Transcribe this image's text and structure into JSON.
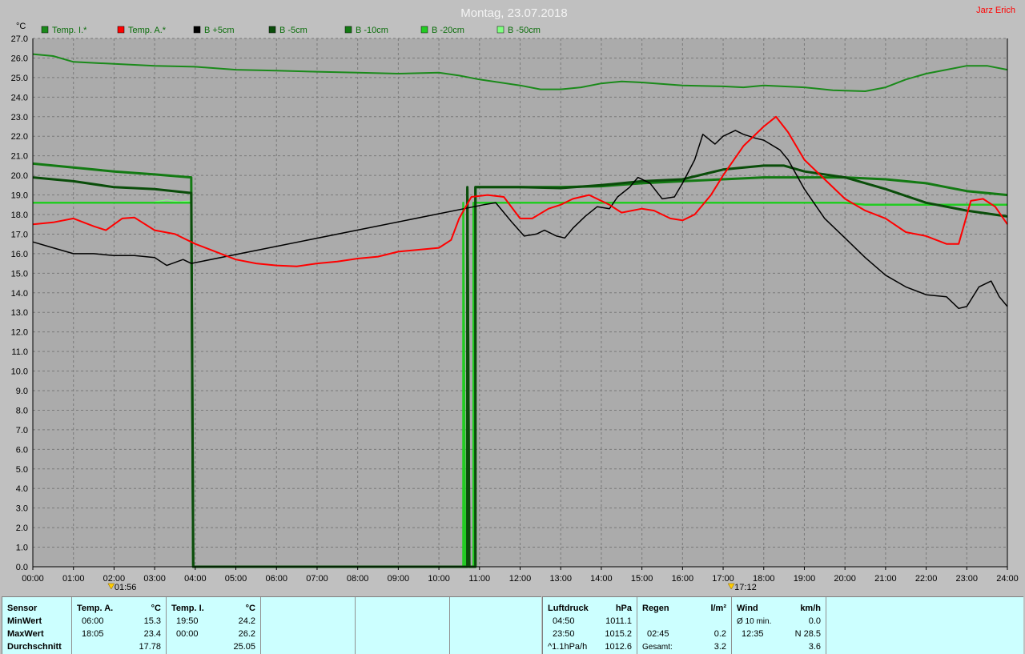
{
  "header": {
    "title": "Montag, 23.07.2018",
    "author": "Jarz Erich",
    "y_unit": "°C"
  },
  "colors": {
    "background": "#c0c0c0",
    "plot_background": "#ababab",
    "grid": "#7a7a7a",
    "temp_inside": "#1a8a1a",
    "temp_outside": "#ff0000",
    "soil_plus5": "#000000",
    "soil_minus5": "#0a4d0a",
    "soil_minus10": "#137a13",
    "soil_minus20": "#22cc22",
    "soil_minus50": "#80ff80"
  },
  "markers": [
    {
      "x": 1.93,
      "label": "01:56",
      "icon": "sunrise-icon"
    },
    {
      "x": 17.2,
      "label": "17:12",
      "icon": "sunset-icon"
    }
  ],
  "chart_data": {
    "type": "line",
    "xlim": [
      0,
      24
    ],
    "ylim": [
      0,
      27
    ],
    "ylabel": "°C",
    "grid": true,
    "legend_position": "top-left",
    "x_ticks": [
      "00:00",
      "01:00",
      "02:00",
      "03:00",
      "04:00",
      "05:00",
      "06:00",
      "07:00",
      "08:00",
      "09:00",
      "10:00",
      "11:00",
      "12:00",
      "13:00",
      "14:00",
      "15:00",
      "16:00",
      "17:00",
      "18:00",
      "19:00",
      "20:00",
      "21:00",
      "22:00",
      "23:00",
      "24:00"
    ],
    "y_ticks": [
      "0.0",
      "1.0",
      "2.0",
      "3.0",
      "4.0",
      "5.0",
      "6.0",
      "7.0",
      "8.0",
      "9.0",
      "10.0",
      "11.0",
      "12.0",
      "13.0",
      "14.0",
      "15.0",
      "16.0",
      "17.0",
      "18.0",
      "19.0",
      "20.0",
      "21.0",
      "22.0",
      "23.0",
      "24.0",
      "25.0",
      "26.0",
      "27.0"
    ],
    "series": [
      {
        "name": "Temp. I.*",
        "color": "#1a8a1a",
        "width": 2,
        "points": [
          [
            0,
            26.2
          ],
          [
            0.5,
            26.1
          ],
          [
            1,
            25.8
          ],
          [
            2,
            25.7
          ],
          [
            3,
            25.6
          ],
          [
            4,
            25.55
          ],
          [
            5,
            25.4
          ],
          [
            6,
            25.35
          ],
          [
            7,
            25.3
          ],
          [
            8,
            25.25
          ],
          [
            9,
            25.2
          ],
          [
            10,
            25.25
          ],
          [
            10.5,
            25.1
          ],
          [
            11,
            24.9
          ],
          [
            12,
            24.6
          ],
          [
            12.5,
            24.4
          ],
          [
            13,
            24.4
          ],
          [
            13.5,
            24.5
          ],
          [
            14,
            24.7
          ],
          [
            14.5,
            24.8
          ],
          [
            15,
            24.75
          ],
          [
            16,
            24.6
          ],
          [
            17,
            24.55
          ],
          [
            17.5,
            24.5
          ],
          [
            18,
            24.6
          ],
          [
            19,
            24.5
          ],
          [
            19.7,
            24.35
          ],
          [
            20.5,
            24.3
          ],
          [
            21,
            24.5
          ],
          [
            21.5,
            24.9
          ],
          [
            22,
            25.2
          ],
          [
            22.5,
            25.4
          ],
          [
            23,
            25.6
          ],
          [
            23.5,
            25.6
          ],
          [
            24,
            25.4
          ]
        ]
      },
      {
        "name": "Temp. A.*",
        "color": "#ff0000",
        "width": 2,
        "points": [
          [
            0,
            17.5
          ],
          [
            0.5,
            17.6
          ],
          [
            1,
            17.8
          ],
          [
            1.5,
            17.4
          ],
          [
            1.8,
            17.2
          ],
          [
            2.2,
            17.8
          ],
          [
            2.5,
            17.85
          ],
          [
            3,
            17.2
          ],
          [
            3.5,
            17.0
          ],
          [
            4,
            16.5
          ],
          [
            4.5,
            16.1
          ],
          [
            5,
            15.7
          ],
          [
            5.5,
            15.5
          ],
          [
            6,
            15.4
          ],
          [
            6.5,
            15.35
          ],
          [
            7,
            15.5
          ],
          [
            7.5,
            15.6
          ],
          [
            8,
            15.75
          ],
          [
            8.5,
            15.85
          ],
          [
            9,
            16.1
          ],
          [
            9.5,
            16.2
          ],
          [
            10,
            16.3
          ],
          [
            10.3,
            16.7
          ],
          [
            10.5,
            17.8
          ],
          [
            10.8,
            18.9
          ],
          [
            11.2,
            19.0
          ],
          [
            11.6,
            18.9
          ],
          [
            12,
            17.8
          ],
          [
            12.3,
            17.8
          ],
          [
            12.7,
            18.3
          ],
          [
            13,
            18.5
          ],
          [
            13.3,
            18.8
          ],
          [
            13.7,
            19.0
          ],
          [
            14.2,
            18.5
          ],
          [
            14.5,
            18.1
          ],
          [
            15,
            18.3
          ],
          [
            15.3,
            18.2
          ],
          [
            15.7,
            17.8
          ],
          [
            16,
            17.7
          ],
          [
            16.3,
            18.0
          ],
          [
            16.7,
            19.0
          ],
          [
            17,
            20.0
          ],
          [
            17.5,
            21.5
          ],
          [
            18,
            22.5
          ],
          [
            18.3,
            23.0
          ],
          [
            18.6,
            22.2
          ],
          [
            19,
            20.8
          ],
          [
            19.5,
            19.8
          ],
          [
            20,
            18.8
          ],
          [
            20.5,
            18.2
          ],
          [
            21,
            17.8
          ],
          [
            21.5,
            17.1
          ],
          [
            22,
            16.9
          ],
          [
            22.5,
            16.5
          ],
          [
            22.8,
            16.5
          ],
          [
            23.1,
            18.7
          ],
          [
            23.4,
            18.8
          ],
          [
            23.7,
            18.4
          ],
          [
            24,
            17.5
          ]
        ]
      },
      {
        "name": "B +5cm",
        "color": "#000000",
        "width": 1.5,
        "points": [
          [
            0,
            16.6
          ],
          [
            0.5,
            16.3
          ],
          [
            1,
            16.0
          ],
          [
            1.5,
            16.0
          ],
          [
            2,
            15.9
          ],
          [
            2.5,
            15.9
          ],
          [
            3,
            15.8
          ],
          [
            3.3,
            15.4
          ],
          [
            3.7,
            15.7
          ],
          [
            3.9,
            15.5
          ],
          [
            11.1,
            18.5
          ],
          [
            11.4,
            18.6
          ],
          [
            11.8,
            17.6
          ],
          [
            12.1,
            16.9
          ],
          [
            12.4,
            17.0
          ],
          [
            12.6,
            17.2
          ],
          [
            12.9,
            16.9
          ],
          [
            13.1,
            16.8
          ],
          [
            13.3,
            17.3
          ],
          [
            13.6,
            17.9
          ],
          [
            13.9,
            18.4
          ],
          [
            14.2,
            18.3
          ],
          [
            14.4,
            18.9
          ],
          [
            14.7,
            19.4
          ],
          [
            14.9,
            19.9
          ],
          [
            15.2,
            19.6
          ],
          [
            15.5,
            18.8
          ],
          [
            15.8,
            18.9
          ],
          [
            16.0,
            19.6
          ],
          [
            16.3,
            20.8
          ],
          [
            16.5,
            22.1
          ],
          [
            16.8,
            21.6
          ],
          [
            17.0,
            22.0
          ],
          [
            17.3,
            22.3
          ],
          [
            17.5,
            22.1
          ],
          [
            17.8,
            21.9
          ],
          [
            18.0,
            21.8
          ],
          [
            18.4,
            21.3
          ],
          [
            18.6,
            20.8
          ],
          [
            19.0,
            19.3
          ],
          [
            19.5,
            17.8
          ],
          [
            20,
            16.8
          ],
          [
            20.5,
            15.8
          ],
          [
            21,
            14.9
          ],
          [
            21.5,
            14.3
          ],
          [
            22,
            13.9
          ],
          [
            22.5,
            13.8
          ],
          [
            22.8,
            13.2
          ],
          [
            23.0,
            13.3
          ],
          [
            23.3,
            14.3
          ],
          [
            23.6,
            14.6
          ],
          [
            23.8,
            13.8
          ],
          [
            24,
            13.3
          ]
        ]
      },
      {
        "name": "B -5cm",
        "color": "#0a4d0a",
        "width": 3,
        "points": [
          [
            0,
            19.9
          ],
          [
            1,
            19.7
          ],
          [
            2,
            19.4
          ],
          [
            3,
            19.3
          ],
          [
            3.9,
            19.1
          ],
          [
            3.95,
            0
          ],
          [
            10.7,
            0
          ],
          [
            10.7,
            19.4
          ],
          [
            10.75,
            0
          ],
          [
            10.9,
            0
          ],
          [
            10.9,
            19.4
          ],
          [
            12,
            19.4
          ],
          [
            13,
            19.35
          ],
          [
            14,
            19.5
          ],
          [
            14.5,
            19.6
          ],
          [
            15,
            19.7
          ],
          [
            16,
            19.8
          ],
          [
            17,
            20.3
          ],
          [
            18,
            20.5
          ],
          [
            18.5,
            20.5
          ],
          [
            19,
            20.2
          ],
          [
            20,
            19.9
          ],
          [
            21,
            19.3
          ],
          [
            22,
            18.6
          ],
          [
            23,
            18.2
          ],
          [
            24,
            17.9
          ]
        ]
      },
      {
        "name": "B -10cm",
        "color": "#137a13",
        "width": 3,
        "points": [
          [
            0,
            20.6
          ],
          [
            1,
            20.4
          ],
          [
            2,
            20.2
          ],
          [
            3,
            20.05
          ],
          [
            3.9,
            19.9
          ],
          [
            3.95,
            0
          ],
          [
            10.7,
            0
          ],
          [
            10.7,
            19.3
          ],
          [
            10.75,
            0
          ],
          [
            10.9,
            0
          ],
          [
            10.9,
            19.4
          ],
          [
            12,
            19.4
          ],
          [
            13,
            19.4
          ],
          [
            14,
            19.45
          ],
          [
            15,
            19.6
          ],
          [
            16,
            19.7
          ],
          [
            17,
            19.8
          ],
          [
            18,
            19.9
          ],
          [
            19,
            19.9
          ],
          [
            20,
            19.9
          ],
          [
            21,
            19.8
          ],
          [
            22,
            19.6
          ],
          [
            22.5,
            19.4
          ],
          [
            23,
            19.2
          ],
          [
            24,
            19.0
          ]
        ]
      },
      {
        "name": "B -20cm",
        "color": "#22cc22",
        "width": 2.5,
        "points": [
          [
            0,
            18.6
          ],
          [
            1,
            18.6
          ],
          [
            2,
            18.6
          ],
          [
            3,
            18.6
          ],
          [
            3.9,
            18.6
          ],
          [
            3.95,
            0
          ],
          [
            10.6,
            0
          ],
          [
            10.6,
            18.6
          ],
          [
            10.65,
            0
          ],
          [
            10.85,
            0
          ],
          [
            10.85,
            18.6
          ],
          [
            12,
            18.6
          ],
          [
            13,
            18.6
          ],
          [
            14,
            18.6
          ],
          [
            15,
            18.6
          ],
          [
            16,
            18.6
          ],
          [
            17,
            18.6
          ],
          [
            18,
            18.6
          ],
          [
            19,
            18.6
          ],
          [
            20,
            18.6
          ],
          [
            20.5,
            18.5
          ],
          [
            21,
            18.5
          ],
          [
            22,
            18.5
          ],
          [
            23,
            18.5
          ],
          [
            24,
            18.5
          ]
        ]
      },
      {
        "name": "B -50cm",
        "color": "#80ff80",
        "width": 1,
        "points": [
          [
            3.0,
            18.65
          ],
          [
            3.3,
            18.75
          ],
          [
            3.6,
            18.65
          ],
          [
            3.9,
            18.7
          ]
        ]
      }
    ]
  },
  "stats": {
    "sensor_col": {
      "header": "Sensor",
      "min": "MinWert",
      "max": "MaxWert",
      "avg": "Durchschnitt"
    },
    "temp_a": {
      "header": "Temp. A.",
      "unit": "°C",
      "min_time": "06:00",
      "min_val": "15.3",
      "max_time": "18:05",
      "max_val": "23.4",
      "avg_val": "17.78"
    },
    "temp_i": {
      "header": "Temp. I.",
      "unit": "°C",
      "min_time": "19:50",
      "min_val": "24.2",
      "max_time": "00:00",
      "max_val": "26.2",
      "avg_val": "25.05"
    },
    "pressure": {
      "header": "Luftdruck",
      "unit": "hPa",
      "min_time": "04:50",
      "min_val": "1011.1",
      "max_time": "23:50",
      "max_val": "1015.2",
      "trend_label": "^1.1hPa/h",
      "avg_val": "1012.6"
    },
    "rain": {
      "header": "Regen",
      "unit": "l/m²",
      "row2_time": "02:45",
      "row2_val": "0.2",
      "total_label": "Gesamt:",
      "total_val": "3.2"
    },
    "wind": {
      "header": "Wind",
      "unit": "km/h",
      "avg10_label": "Ø 10 min.",
      "avg10_val": "0.0",
      "max_time": "12:35",
      "max_val": "N 28.5",
      "avg_val": "3.6"
    }
  }
}
